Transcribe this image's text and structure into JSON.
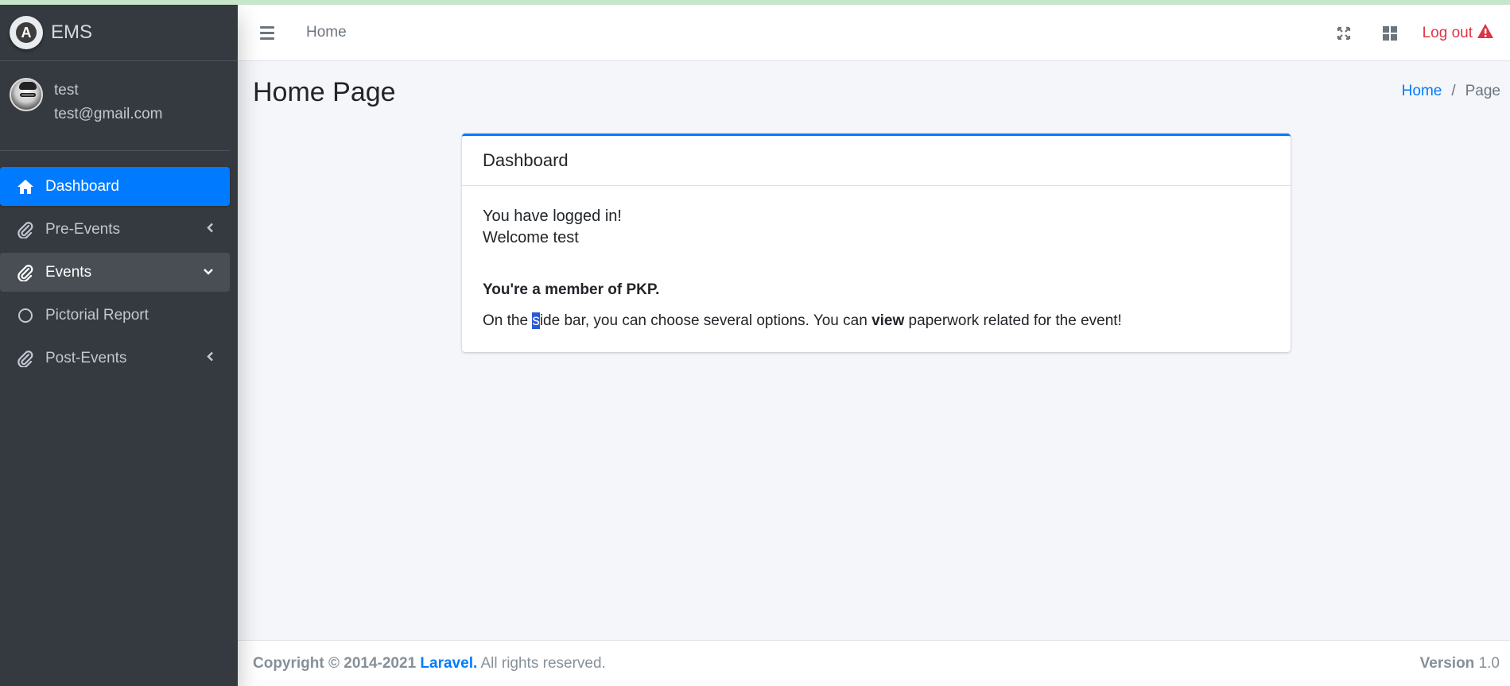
{
  "brand": {
    "name": "EMS"
  },
  "user": {
    "name": "test",
    "email": "test@gmail.com"
  },
  "sidebar": {
    "items": [
      {
        "label": "Dashboard",
        "icon": "home-icon",
        "state": "active"
      },
      {
        "label": "Pre-Events",
        "icon": "paperclip-icon",
        "arrow": "chevron-left-icon"
      },
      {
        "label": "Events",
        "icon": "paperclip-icon",
        "arrow": "chevron-down-icon",
        "state": "open"
      },
      {
        "label": "Pictorial Report",
        "icon": "circle-icon"
      },
      {
        "label": "Post-Events",
        "icon": "paperclip-icon",
        "arrow": "chevron-left-icon"
      }
    ]
  },
  "navbar": {
    "home_link": "Home",
    "logout_label": "Log out"
  },
  "header": {
    "title": "Home Page",
    "breadcrumb": {
      "home": "Home",
      "separator": "/",
      "current": "Page"
    }
  },
  "card": {
    "title": "Dashboard",
    "line1": "You have logged in!",
    "line2": "Welcome test",
    "member": "You're a member of PKP.",
    "desc_part1": "On the ",
    "desc_selected": "s",
    "desc_part2": "ide bar, you can choose several options. You can ",
    "desc_bold": "view",
    "desc_part3": " paperwork related for the event!"
  },
  "footer": {
    "copyright": "Copyright © 2014-2021",
    "brand_link": "Laravel.",
    "rights": "All rights reserved.",
    "version_label": "Version",
    "version": "1.0"
  },
  "colors": {
    "accent": "#007bff",
    "sidebar_bg": "#343a40",
    "danger": "#dc3545"
  }
}
